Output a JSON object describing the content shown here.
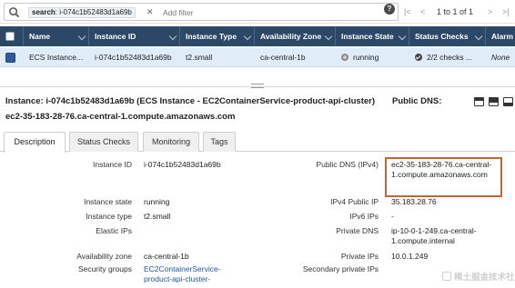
{
  "search": {
    "token_key": "search",
    "token_value": ": i-074c1b52483d1a69b",
    "token_close": "✕",
    "placeholder": "Add filter",
    "help_glyph": "?"
  },
  "pager": {
    "first": "|<",
    "prev": "<",
    "label": "1 to 1 of 1",
    "next": ">",
    "last": ">|"
  },
  "grid": {
    "columns": [
      "Name",
      "Instance ID",
      "Instance Type",
      "Availability Zone",
      "Instance State",
      "Status Checks",
      "Alarm"
    ],
    "row": {
      "name": "ECS Instance...",
      "instance_id": "i-074c1b52483d1a69b",
      "instance_type": "t2.small",
      "availability_zone": "ca-central-1b",
      "instance_state": "running",
      "status_checks": "2/2 checks ...",
      "alarm": "None"
    }
  },
  "detail": {
    "instance_label": "Instance:",
    "instance_value": "i-074c1b52483d1a69b (ECS Instance - EC2ContainerService-product-api-cluster)",
    "public_dns_label": "Public DNS:",
    "subtitle": "ec2-35-183-28-76.ca-central-1.compute.amazonaws.com",
    "tabs": [
      "Description",
      "Status Checks",
      "Monitoring",
      "Tags"
    ],
    "active_tab": "Description"
  },
  "fields": {
    "instance_id_label": "Instance ID",
    "instance_id": "i-074c1b52483d1a69b",
    "instance_state_label": "Instance state",
    "instance_state": "running",
    "instance_type_label": "Instance type",
    "instance_type": "t2.small",
    "elastic_ips_label": "Elastic IPs",
    "availability_zone_label": "Availability zone",
    "availability_zone": "ca-central-1b",
    "security_groups_label": "Security groups",
    "security_groups": "EC2ContainerService-product-api-cluster-",
    "public_dns_ipv4_label": "Public DNS (IPv4)",
    "public_dns_ipv4": "ec2-35-183-28-76.ca-central-1.compute.amazonaws.com",
    "ipv4_public_ip_label": "IPv4 Public IP",
    "ipv4_public_ip": "35.183.28.76",
    "ipv6_ips_label": "IPv6 IPs",
    "ipv6_ips": "-",
    "private_dns_label": "Private DNS",
    "private_dns": "ip-10-0-1-249.ca-central-1.compute.internal",
    "private_ips_label": "Private IPs",
    "private_ips": "10.0.1.249",
    "secondary_private_ips_label": "Secondary private IPs"
  },
  "watermark": "稀土掘金技术社区",
  "colors": {
    "grid_header_bg": "#2d4866",
    "selected_row_bg": "#e0ecf8",
    "highlight_box": "#c0663a",
    "link": "#1a5aa6"
  }
}
